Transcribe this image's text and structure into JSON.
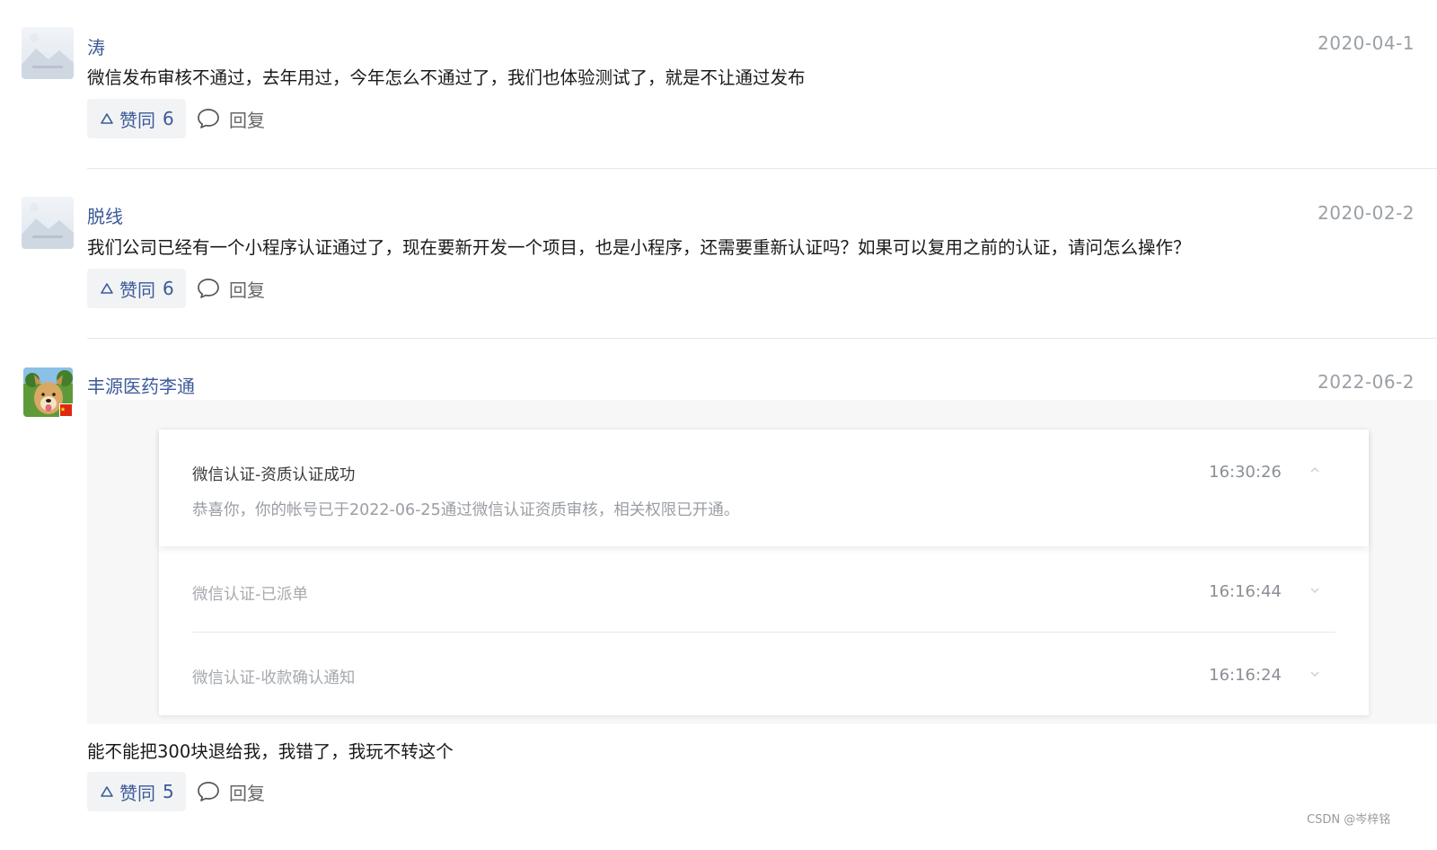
{
  "comments": [
    {
      "author": "涛",
      "date": "2020-04-1",
      "text": "微信发布审核不通过，去年用过，今年怎么不通过了，我们也体验测试了，就是不让通过发布",
      "like_label": "赞同",
      "like_count": "6",
      "reply_label": "回复"
    },
    {
      "author": "脱线",
      "date": "2020-02-2",
      "text": "我们公司已经有一个小程序认证通过了，现在要新开发一个项目，也是小程序，还需要重新认证吗？如果可以复用之前的认证，请问怎么操作？",
      "like_label": "赞同",
      "like_count": "6",
      "reply_label": "回复"
    },
    {
      "author": "丰源医药李通",
      "date": "2022-06-2",
      "text": "能不能把300块退给我，我错了，我玩不转这个",
      "like_label": "赞同",
      "like_count": "5",
      "reply_label": "回复"
    }
  ],
  "embed": {
    "notifications": [
      {
        "title": "微信认证-资质认证成功",
        "time": "16:30:26",
        "description": "恭喜你，你的帐号已于2022-06-25通过微信认证资质审核，相关权限已开通。",
        "expanded": true
      },
      {
        "title": "微信认证-已派单",
        "time": "16:16:44",
        "expanded": false
      },
      {
        "title": "微信认证-收款确认通知",
        "time": "16:16:24",
        "expanded": false
      }
    ]
  },
  "watermark": "CSDN @岑梓铭",
  "colors": {
    "author": "#3c5a99",
    "date": "#9aa0a6",
    "like_bg": "#f2f3f5",
    "divider": "#e6e8eb"
  },
  "icons": {
    "avatar_placeholder": "image-placeholder-icon",
    "like": "triangle-up-icon",
    "reply": "speech-bubble-icon",
    "chevron_up": "chevron-up-icon",
    "chevron_down": "chevron-down-icon"
  }
}
